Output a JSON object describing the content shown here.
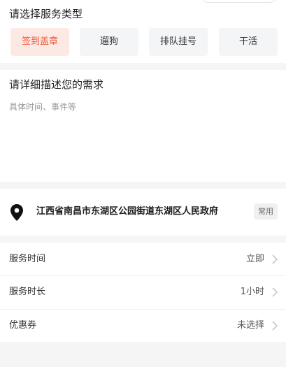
{
  "service": {
    "title": "请选择服务类型",
    "types": [
      {
        "label": "签到盖章",
        "active": true
      },
      {
        "label": "遛狗",
        "active": false
      },
      {
        "label": "排队挂号",
        "active": false
      },
      {
        "label": "干活",
        "active": false
      }
    ]
  },
  "description": {
    "title": "请详细描述您的需求",
    "placeholder": "具体时间、事件等",
    "value": ""
  },
  "address": {
    "text": "江西省南昌市东湖区公园街道东湖区人民政府",
    "tag": "常用",
    "icon": "location-pin-icon"
  },
  "options": [
    {
      "label": "服务时间",
      "value": "立即"
    },
    {
      "label": "服务时长",
      "value": "1小时"
    },
    {
      "label": "优惠券",
      "value": "未选择"
    }
  ],
  "colors": {
    "accent": "#f05a3e",
    "accent_bg": "#fde9e4",
    "chip_bg": "#f4f5f7",
    "page_bg": "#f5f5f6"
  }
}
